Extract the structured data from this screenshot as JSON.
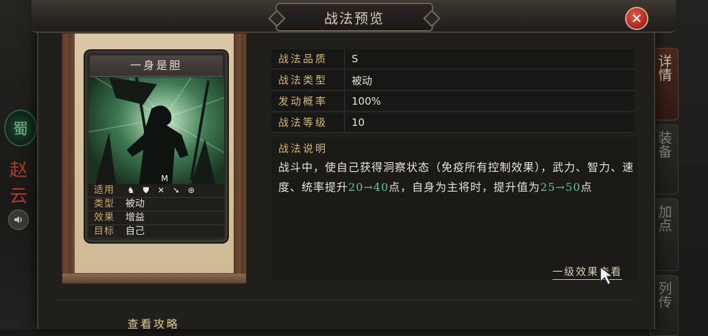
{
  "background": {
    "faction": "蜀",
    "hero_name": "赵云",
    "sound_icon": "speaker-icon",
    "side_tabs": [
      {
        "label": "详情",
        "active": true
      },
      {
        "label": "装备",
        "active": false
      },
      {
        "label": "加点",
        "active": false
      },
      {
        "label": "列传",
        "active": false
      }
    ]
  },
  "dialog": {
    "title": "战法预览",
    "close_icon": "close-icon"
  },
  "card": {
    "name": "一身是胆",
    "info": [
      {
        "key": "适用",
        "icons": [
          "cavalry-icon",
          "shield-icon",
          "bow-icon",
          "spear-icon",
          "chariot-icon"
        ]
      },
      {
        "key": "类型",
        "value": "被动"
      },
      {
        "key": "效果",
        "value": "增益"
      },
      {
        "key": "目标",
        "value": "自己"
      }
    ]
  },
  "properties": [
    {
      "key": "战法品质",
      "value": "S"
    },
    {
      "key": "战法类型",
      "value": "被动"
    },
    {
      "key": "发动概率",
      "value": "100%"
    },
    {
      "key": "战法等级",
      "value": "10"
    }
  ],
  "description": {
    "key": "战法说明",
    "part1": "战斗中，使自己获得洞察状态（免疫所有控制效果），武力、智力、速度、统率提升",
    "hl1": "20→40",
    "part2": "点，自身为主将时，提升值为",
    "hl2": "25→50",
    "part3": "点"
  },
  "links": {
    "level_effect": "一级效果查看",
    "guide": "查看攻略"
  },
  "colors": {
    "accent_gold": "#d7b877",
    "highlight_green": "#5fc494",
    "close_red": "#a5261d"
  }
}
